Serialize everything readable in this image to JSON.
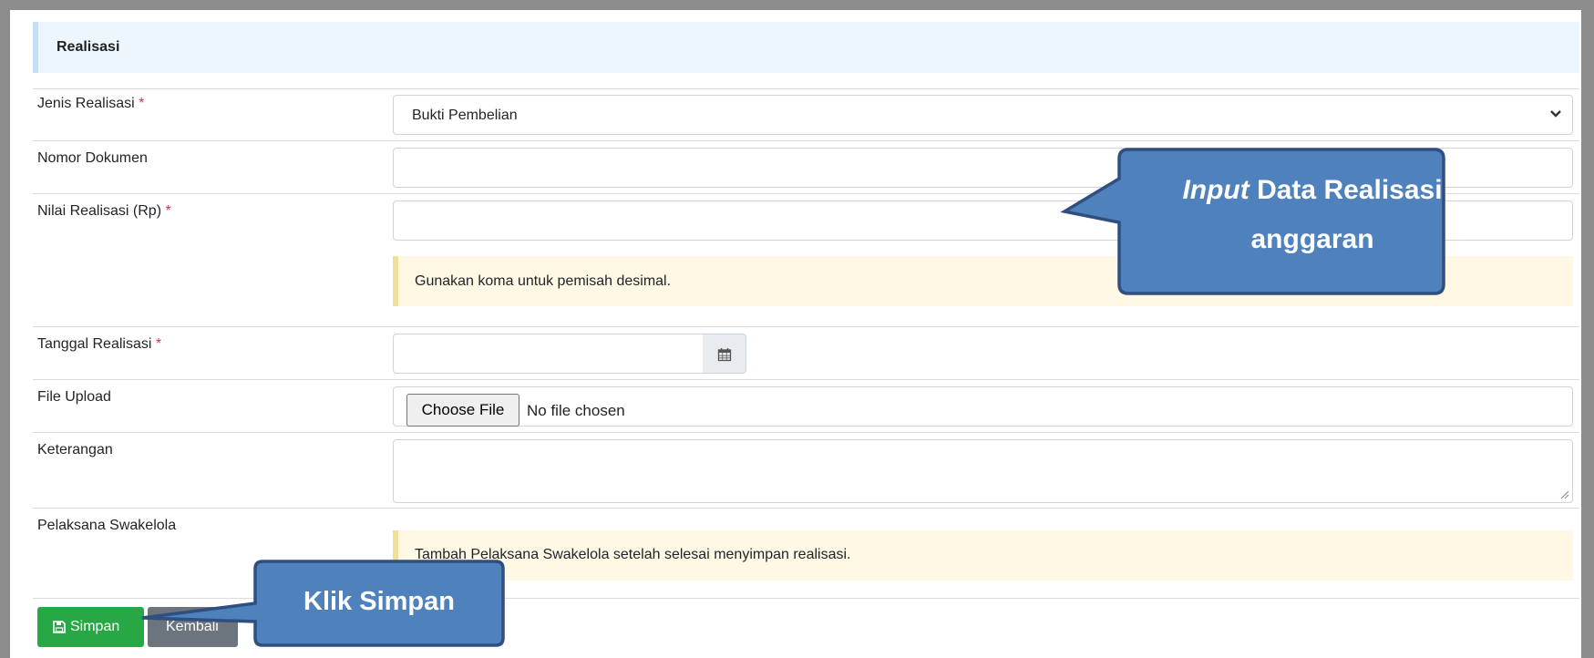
{
  "panel": {
    "title": "Realisasi"
  },
  "form": {
    "jenis": {
      "label": "Jenis Realisasi",
      "required": "*",
      "value": "Bukti Pembelian"
    },
    "nomor": {
      "label": "Nomor Dokumen",
      "value": ""
    },
    "nilai": {
      "label": "Nilai Realisasi (Rp)",
      "required": "*",
      "value": "",
      "hint": "Gunakan koma untuk pemisah desimal."
    },
    "tanggal": {
      "label": "Tanggal Realisasi",
      "required": "*",
      "value": ""
    },
    "file": {
      "label": "File Upload",
      "button": "Choose File",
      "status": "No file chosen"
    },
    "keterangan": {
      "label": "Keterangan",
      "value": ""
    },
    "pelaksana": {
      "label": "Pelaksana Swakelola",
      "info": "Tambah Pelaksana Swakelola setelah selesai menyimpan realisasi."
    }
  },
  "buttons": {
    "save": "Simpan",
    "back": "Kembali"
  },
  "callouts": {
    "input": {
      "italic": "Input",
      "rest": " Data Realisasi",
      "line2": "anggaran"
    },
    "save": "Klik Simpan"
  },
  "colors": {
    "callout_fill": "#4f81bd",
    "callout_border": "#2f4f80",
    "save_button": "#28a745",
    "back_button": "#6c757d",
    "required": "#dc3545"
  },
  "icons": {
    "calendar": "calendar-icon",
    "save": "floppy-disk-icon",
    "select": "chevron-down-icon",
    "resize": "resize-handle-icon"
  }
}
